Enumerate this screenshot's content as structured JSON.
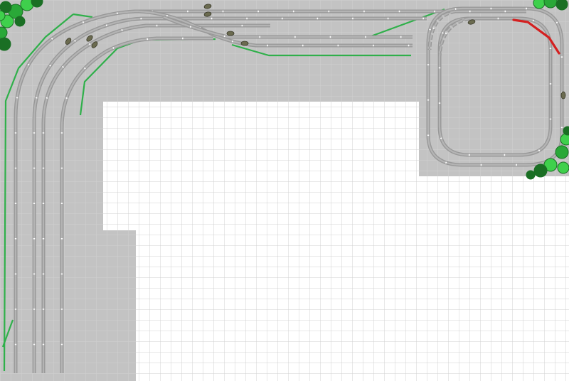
{
  "colors": {
    "background": "#ffffff",
    "grid_line": "#d0d0d0",
    "baseboard": "#c3c3c3",
    "track_bed": "#989898",
    "track_rail": "#b4b4b4",
    "track_joint": "#ffffff",
    "scenery_line": "#2fb04a",
    "highlight_track": "#d42020",
    "tree_dark": "#1a6f24",
    "tree_light": "#3fd04c",
    "tree_mid": "#2aa838",
    "rolling_stock": "#6b6b50"
  },
  "layers": [
    "grid",
    "baseboard",
    "scenery-outlines",
    "track",
    "highlight-track",
    "trees",
    "rolling-stock"
  ]
}
